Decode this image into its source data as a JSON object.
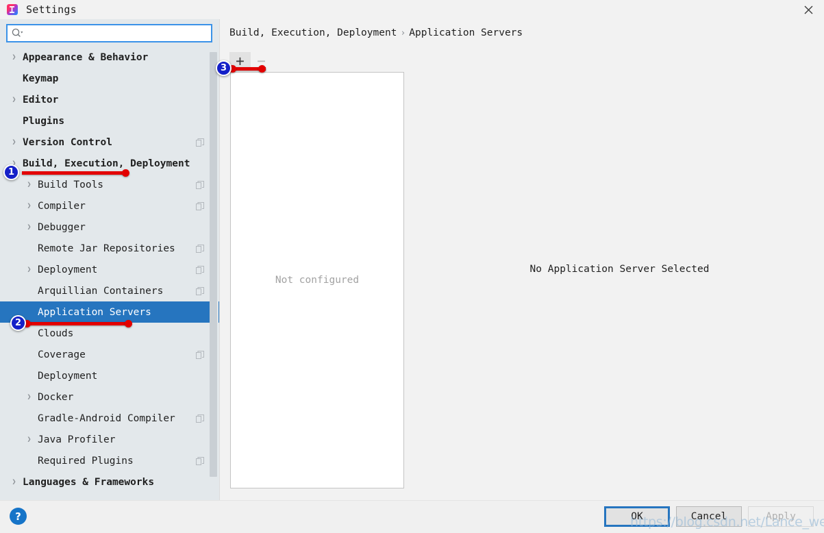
{
  "window": {
    "title": "Settings",
    "app_icon": "intellij-idea-icon",
    "close_icon": "close-icon"
  },
  "search": {
    "value": "",
    "placeholder": "",
    "icon": "search-icon"
  },
  "sidebar": {
    "scrollbar": "vertical-scrollbar",
    "items": [
      {
        "label": "Appearance & Behavior",
        "indent": 0,
        "arrow": true,
        "bold": true,
        "selected": false,
        "badge": false
      },
      {
        "label": "Keymap",
        "indent": 0,
        "arrow": false,
        "bold": true,
        "selected": false,
        "badge": false
      },
      {
        "label": "Editor",
        "indent": 0,
        "arrow": true,
        "bold": true,
        "selected": false,
        "badge": false
      },
      {
        "label": "Plugins",
        "indent": 0,
        "arrow": false,
        "bold": true,
        "selected": false,
        "badge": false
      },
      {
        "label": "Version Control",
        "indent": 0,
        "arrow": true,
        "bold": true,
        "selected": false,
        "badge": true
      },
      {
        "label": "Build, Execution, Deployment",
        "indent": 0,
        "arrow": true,
        "bold": true,
        "selected": false,
        "badge": false
      },
      {
        "label": "Build Tools",
        "indent": 1,
        "arrow": true,
        "bold": false,
        "selected": false,
        "badge": true
      },
      {
        "label": "Compiler",
        "indent": 1,
        "arrow": true,
        "bold": false,
        "selected": false,
        "badge": true
      },
      {
        "label": "Debugger",
        "indent": 1,
        "arrow": true,
        "bold": false,
        "selected": false,
        "badge": false
      },
      {
        "label": "Remote Jar Repositories",
        "indent": 1,
        "arrow": false,
        "bold": false,
        "selected": false,
        "badge": true
      },
      {
        "label": "Deployment",
        "indent": 1,
        "arrow": true,
        "bold": false,
        "selected": false,
        "badge": true
      },
      {
        "label": "Arquillian Containers",
        "indent": 1,
        "arrow": false,
        "bold": false,
        "selected": false,
        "badge": true
      },
      {
        "label": "Application Servers",
        "indent": 1,
        "arrow": false,
        "bold": false,
        "selected": true,
        "badge": false
      },
      {
        "label": "Clouds",
        "indent": 1,
        "arrow": false,
        "bold": false,
        "selected": false,
        "badge": false
      },
      {
        "label": "Coverage",
        "indent": 1,
        "arrow": false,
        "bold": false,
        "selected": false,
        "badge": true
      },
      {
        "label": "Deployment",
        "indent": 1,
        "arrow": false,
        "bold": false,
        "selected": false,
        "badge": false
      },
      {
        "label": "Docker",
        "indent": 1,
        "arrow": true,
        "bold": false,
        "selected": false,
        "badge": false
      },
      {
        "label": "Gradle-Android Compiler",
        "indent": 1,
        "arrow": false,
        "bold": false,
        "selected": false,
        "badge": true
      },
      {
        "label": "Java Profiler",
        "indent": 1,
        "arrow": true,
        "bold": false,
        "selected": false,
        "badge": false
      },
      {
        "label": "Required Plugins",
        "indent": 1,
        "arrow": false,
        "bold": false,
        "selected": false,
        "badge": true
      },
      {
        "label": "Languages & Frameworks",
        "indent": 0,
        "arrow": true,
        "bold": true,
        "selected": false,
        "badge": false
      }
    ]
  },
  "content": {
    "breadcrumb": {
      "parent": "Build, Execution, Deployment",
      "separator": "›",
      "current": "Application Servers"
    },
    "toolbar": {
      "add_label": "+",
      "remove_label": "−"
    },
    "list_empty_text": "Not configured",
    "detail_message": "No Application Server Selected"
  },
  "footer": {
    "help_label": "?",
    "ok_label": "OK",
    "cancel_label": "Cancel",
    "apply_label": "Apply"
  },
  "annotations": [
    {
      "number": "1",
      "target": "Build, Execution, Deployment"
    },
    {
      "number": "2",
      "target": "Application Servers"
    },
    {
      "number": "3",
      "target": "add-server-button"
    }
  ],
  "watermark": "https://blog.csdn.net/Lance_welcome",
  "colors": {
    "selection": "#2675bf",
    "accent": "#3a92e8",
    "annotation_badge": "#1520c8",
    "annotation_line": "#e30000",
    "sidebar_bg": "#e3e8eb",
    "panel_bg": "#f2f2f2"
  }
}
